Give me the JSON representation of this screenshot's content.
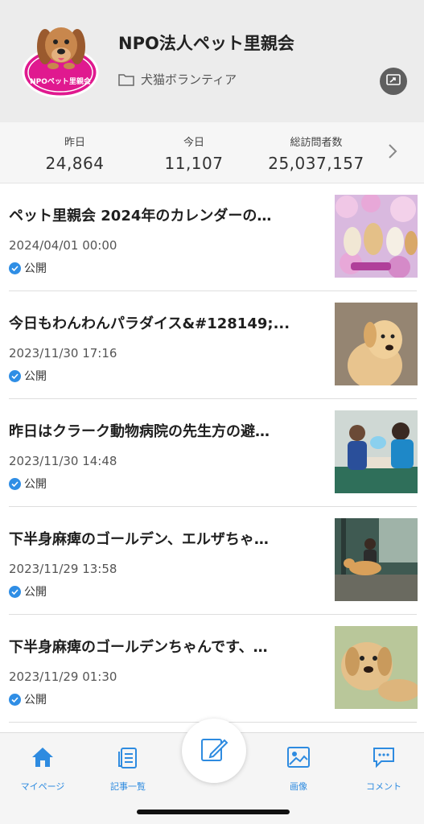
{
  "header": {
    "blog_title": "NPO法人ペット里親会",
    "category": "犬猫ボランティア",
    "logo_text": "NPOペット里親会"
  },
  "stats": {
    "yesterday_label": "昨日",
    "yesterday_value": "24,864",
    "today_label": "今日",
    "today_value": "11,107",
    "total_label": "総訪問者数",
    "total_value": "25,037,157"
  },
  "posts": [
    {
      "title": "ペット里親会 2024年のカレンダーの…",
      "date": "2024/04/01 00:00",
      "status": "公開",
      "thumb_icon": "calendar-dogs-photo"
    },
    {
      "title": "今日もわんわんパラダイス&#128149;...",
      "date": "2023/11/30 17:16",
      "status": "公開",
      "thumb_icon": "golden-retriever-photo"
    },
    {
      "title": "昨日はクラーク動物病院の先生方の避…",
      "date": "2023/11/30 14:48",
      "status": "公開",
      "thumb_icon": "vet-clinic-photo"
    },
    {
      "title": "下半身麻痺のゴールデン、エルザちゃ…",
      "date": "2023/11/29 13:58",
      "status": "公開",
      "thumb_icon": "golden-walking-photo"
    },
    {
      "title": "下半身麻痺のゴールデンちゃんです、…",
      "date": "2023/11/29 01:30",
      "status": "公開",
      "thumb_icon": "golden-lying-photo"
    }
  ],
  "tabs": {
    "mypage": "マイページ",
    "articles": "記事一覧",
    "images": "画像",
    "comments": "コメント"
  },
  "colors": {
    "accent": "#2e8be0",
    "header_bg": "#ececec",
    "logo_magenta": "#e0198f"
  }
}
